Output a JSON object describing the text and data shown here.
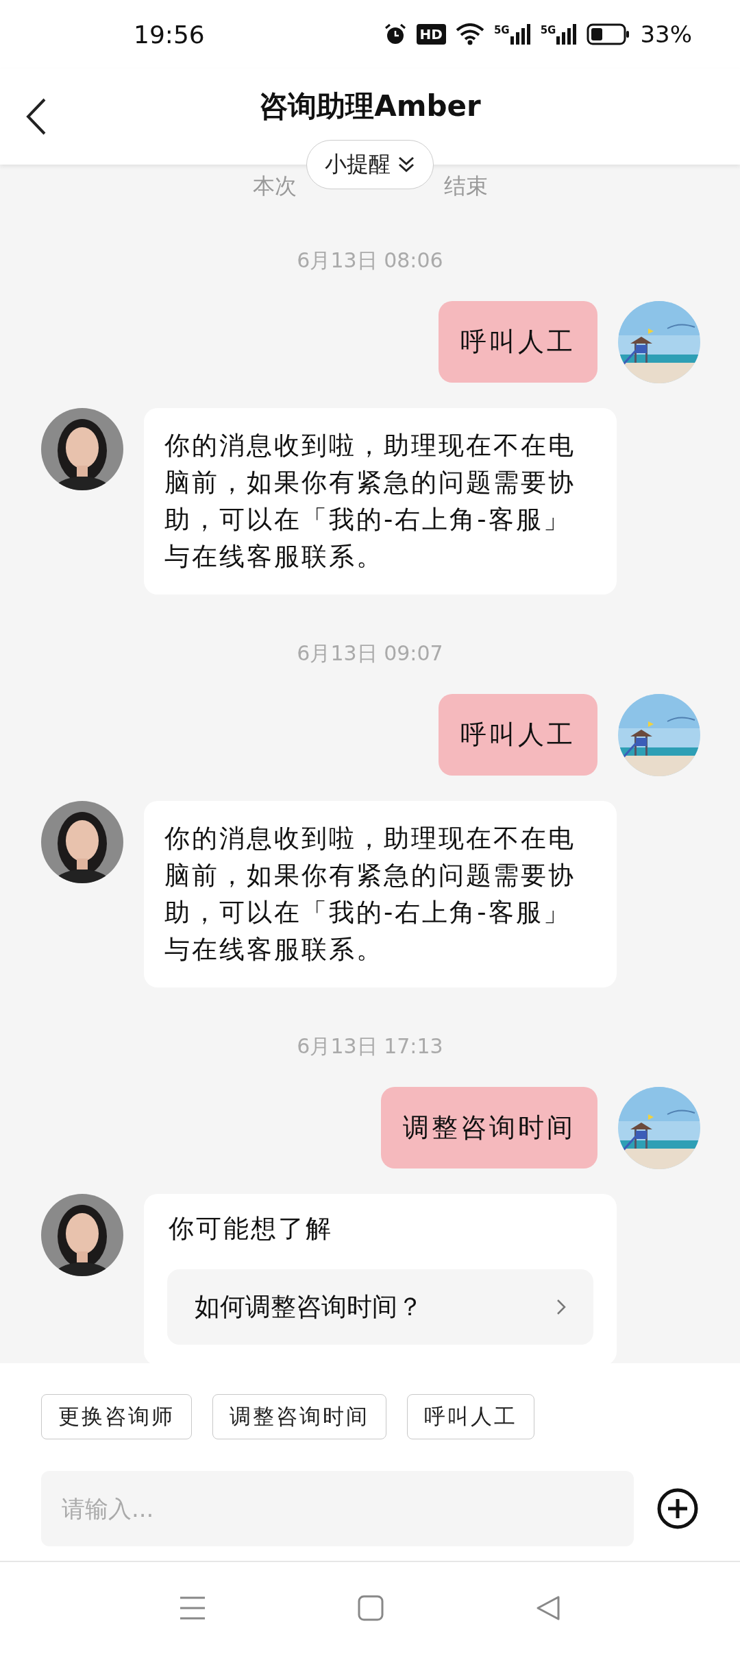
{
  "status_bar": {
    "time": "19:56",
    "hd_label": "HD",
    "network_labels": [
      "5G",
      "5G"
    ],
    "battery": "33%"
  },
  "header": {
    "title": "咨询助理Amber"
  },
  "reminder": {
    "label": "小提醒",
    "notice_parts": [
      "本次",
      "结束"
    ]
  },
  "messages": [
    {
      "kind": "time",
      "text": "6月13日 08:06"
    },
    {
      "kind": "user",
      "text": "呼叫人工"
    },
    {
      "kind": "bot",
      "text": "你的消息收到啦，助理现在不在电脑前，如果你有紧急的问题需要协助，可以在「我的-右上角-客服」与在线客服联系。"
    },
    {
      "kind": "time",
      "text": "6月13日 09:07"
    },
    {
      "kind": "user",
      "text": "呼叫人工"
    },
    {
      "kind": "bot",
      "text": "你的消息收到啦，助理现在不在电脑前，如果你有紧急的问题需要协助，可以在「我的-右上角-客服」与在线客服联系。"
    },
    {
      "kind": "time",
      "text": "6月13日 17:13"
    },
    {
      "kind": "user",
      "text": "调整咨询时间"
    },
    {
      "kind": "suggest",
      "text": "你可能想了解",
      "items": [
        "如何调整咨询时间？"
      ]
    }
  ],
  "quick_replies": [
    "更换咨询师",
    "调整咨询时间",
    "呼叫人工"
  ],
  "input": {
    "placeholder": "请输入..."
  }
}
